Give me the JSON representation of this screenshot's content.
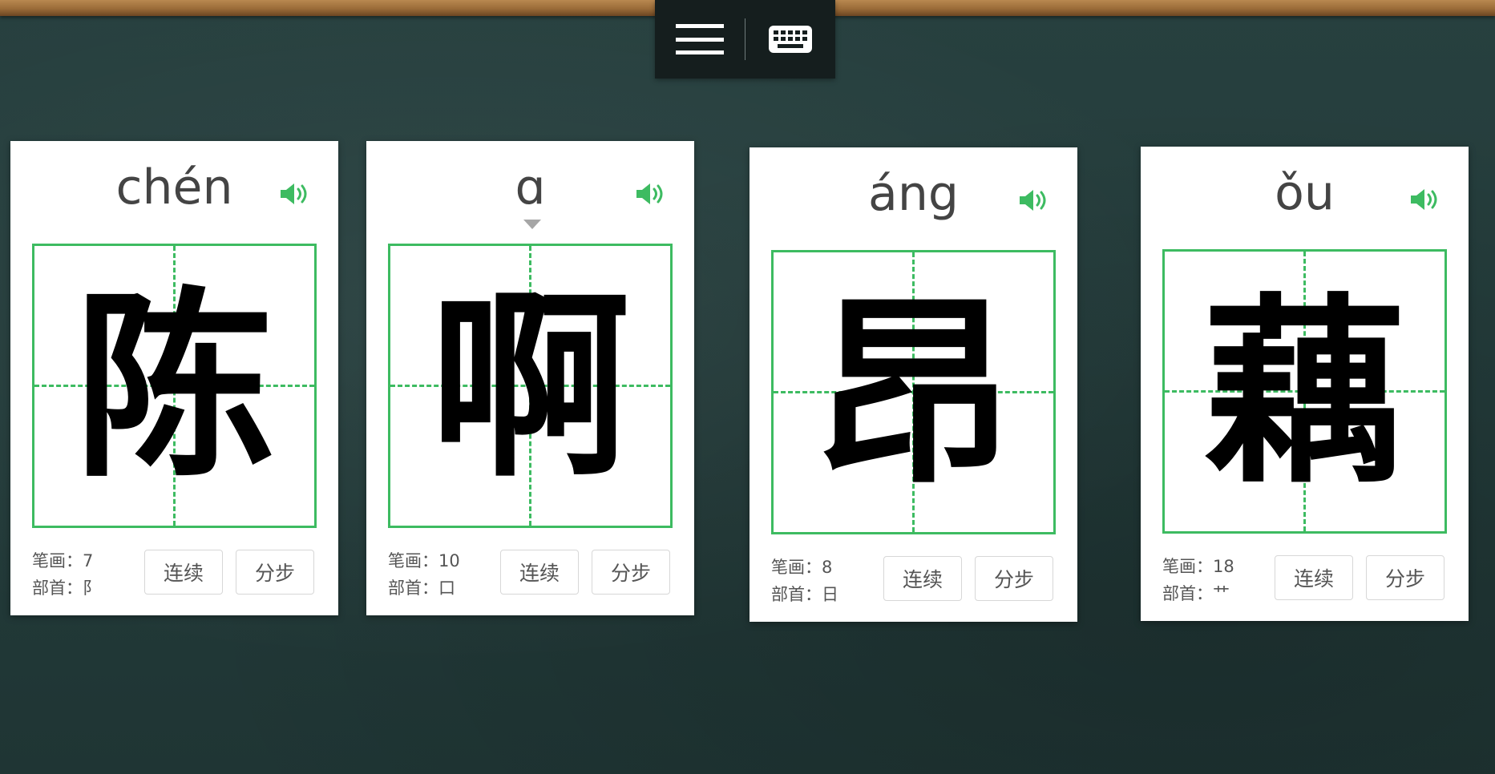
{
  "toolbar": {
    "menu_icon": "hamburger-menu-icon",
    "keyboard_icon": "keyboard-icon"
  },
  "colors": {
    "accent_green": "#3dbb61",
    "chalkboard": "#27403f",
    "text_gray": "#444444"
  },
  "cards": [
    {
      "pinyin": "chén",
      "character": "陈",
      "strokes_label": "笔画：",
      "strokes": "7",
      "radical_label": "部首：",
      "radical": "阝",
      "continuous_label": "连续",
      "step_label": "分步"
    },
    {
      "pinyin": "ɑ",
      "character": "啊",
      "strokes_label": "笔画：",
      "strokes": "10",
      "radical_label": "部首：",
      "radical": "口",
      "continuous_label": "连续",
      "step_label": "分步"
    },
    {
      "pinyin": "áng",
      "character": "昂",
      "strokes_label": "笔画：",
      "strokes": "8",
      "radical_label": "部首：",
      "radical": "日",
      "continuous_label": "连续",
      "step_label": "分步"
    },
    {
      "pinyin": "ǒu",
      "character": "藕",
      "strokes_label": "笔画：",
      "strokes": "18",
      "radical_label": "部首：",
      "radical": "艹",
      "continuous_label": "连续",
      "step_label": "分步"
    }
  ]
}
